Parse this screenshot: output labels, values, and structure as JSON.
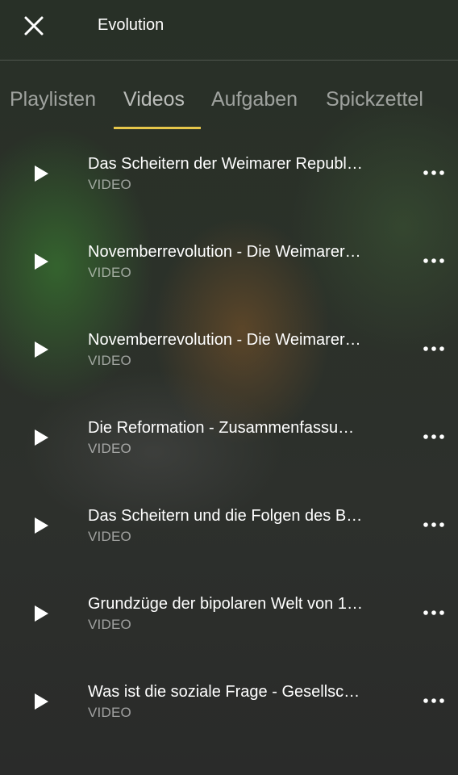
{
  "header": {
    "title": "Evolution",
    "close_icon": "close-icon"
  },
  "tabs": [
    {
      "label": "Playlisten",
      "active": false
    },
    {
      "label": "Videos",
      "active": true
    },
    {
      "label": "Aufgaben",
      "active": false
    },
    {
      "label": "Spickzettel",
      "active": false
    }
  ],
  "accent_color": "#e6c64a",
  "videos": [
    {
      "title": "Das Scheitern der Weimarer Republ…",
      "type": "VIDEO"
    },
    {
      "title": "Novemberrevolution - Die Weimarer…",
      "type": "VIDEO"
    },
    {
      "title": "Novemberrevolution - Die Weimarer…",
      "type": "VIDEO"
    },
    {
      "title": "Die Reformation - Zusammenfassu…",
      "type": "VIDEO"
    },
    {
      "title": "Das Scheitern und die Folgen des B…",
      "type": "VIDEO"
    },
    {
      "title": "Grundzüge der bipolaren Welt von 1…",
      "type": "VIDEO"
    },
    {
      "title": "Was ist die soziale Frage - Gesellsc…",
      "type": "VIDEO"
    }
  ]
}
